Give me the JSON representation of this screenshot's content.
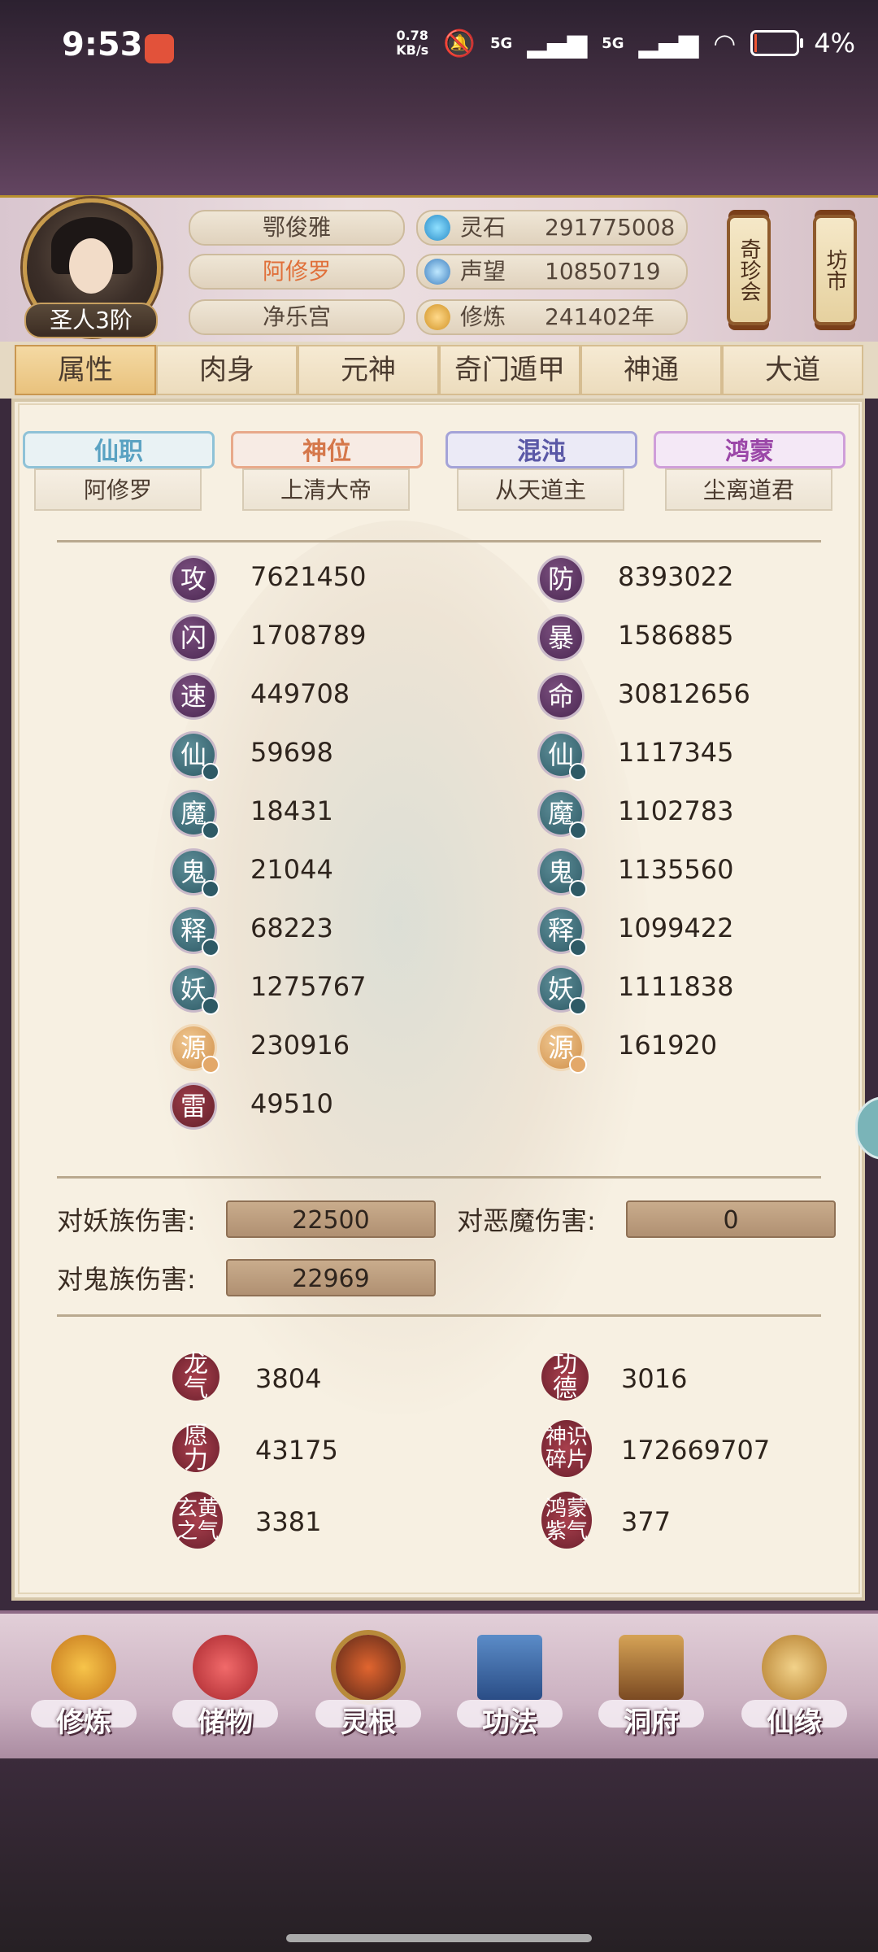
{
  "status_bar": {
    "time": "9:53",
    "net_speed_top": "0.78",
    "net_speed_unit": "KB/s",
    "sig1": "5G",
    "sig2": "5G",
    "battery": "4%"
  },
  "header": {
    "name": "鄂俊雅",
    "title": "阿修罗",
    "sect": "净乐宫",
    "rank": "圣人3阶",
    "resources": [
      {
        "label": "灵石",
        "value": "291775008",
        "icon": "spirit-stone-icon"
      },
      {
        "label": "声望",
        "value": "10850719",
        "icon": "prestige-icon"
      },
      {
        "label": "修炼",
        "value": "241402年",
        "icon": "cultivation-icon"
      }
    ],
    "side_buttons": [
      "奇珍会",
      "坊市"
    ]
  },
  "tabs": [
    "属性",
    "肉身",
    "元神",
    "奇门遁甲",
    "神通",
    "大道"
  ],
  "positions": [
    {
      "title": "仙职",
      "value": "阿修罗",
      "color": "#5aa2c2"
    },
    {
      "title": "神位",
      "value": "上清大帝",
      "color": "#d5774a"
    },
    {
      "title": "混沌",
      "value": "从天道主",
      "color": "#5a58a6"
    },
    {
      "title": "鸿蒙",
      "value": "尘离道君",
      "color": "#9b47a8"
    }
  ],
  "stats_left": [
    {
      "glyph": "攻",
      "value": "7621450"
    },
    {
      "glyph": "闪",
      "value": "1708789"
    },
    {
      "glyph": "速",
      "value": "449708"
    },
    {
      "glyph": "仙",
      "value": "59698"
    },
    {
      "glyph": "魔",
      "value": "18431"
    },
    {
      "glyph": "鬼",
      "value": "21044"
    },
    {
      "glyph": "释",
      "value": "68223"
    },
    {
      "glyph": "妖",
      "value": "1275767"
    },
    {
      "glyph": "源",
      "value": "230916"
    },
    {
      "glyph": "雷",
      "value": "49510"
    }
  ],
  "stats_right": [
    {
      "glyph": "防",
      "value": "8393022"
    },
    {
      "glyph": "暴",
      "value": "1586885"
    },
    {
      "glyph": "命",
      "value": "30812656"
    },
    {
      "glyph": "仙",
      "value": "1117345"
    },
    {
      "glyph": "魔",
      "value": "1102783"
    },
    {
      "glyph": "鬼",
      "value": "1135560"
    },
    {
      "glyph": "释",
      "value": "1099422"
    },
    {
      "glyph": "妖",
      "value": "1111838"
    },
    {
      "glyph": "源",
      "value": "161920"
    }
  ],
  "damage": [
    {
      "label": "对妖族伤害:",
      "value": "22500"
    },
    {
      "label": "对恶魔伤害:",
      "value": "0"
    },
    {
      "label": "对鬼族伤害:",
      "value": "22969"
    }
  ],
  "resources_bottom": [
    {
      "name": "龙气",
      "value": "3804"
    },
    {
      "name": "功德",
      "value": "3016"
    },
    {
      "name": "愿力",
      "value": "43175"
    },
    {
      "name": "神识碎片",
      "value": "172669707"
    },
    {
      "name": "玄黄之气",
      "value": "3381"
    },
    {
      "name": "鸿蒙紫气",
      "value": "377"
    }
  ],
  "nav": [
    "修炼",
    "储物",
    "灵根",
    "功法",
    "洞府",
    "仙缘"
  ]
}
